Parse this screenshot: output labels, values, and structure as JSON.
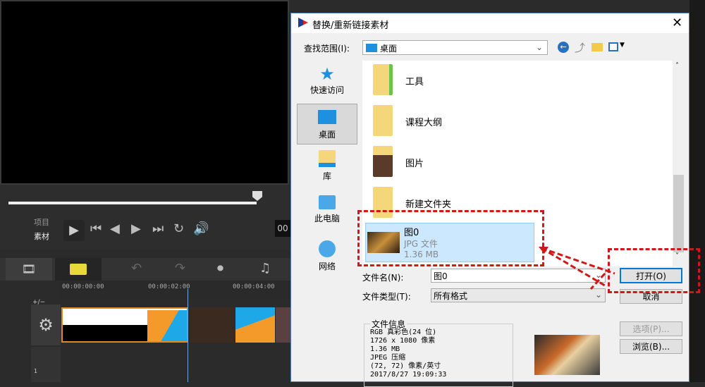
{
  "app": {
    "source_labels": [
      "项目",
      "素材"
    ],
    "timecodes": [
      "00:00:00:00",
      "00:00:02:00",
      "00:00:04:00"
    ],
    "track_label": "+/−",
    "track_number": "1",
    "timecode_box": "00"
  },
  "dialog": {
    "title": "替换/重新链接素材",
    "look_in_label": "查找范围(I):",
    "look_in_value": "桌面",
    "nav": [
      {
        "label": "快速访问",
        "icon": "star-icon"
      },
      {
        "label": "桌面",
        "icon": "desktop-icon",
        "selected": true
      },
      {
        "label": "库",
        "icon": "library-icon"
      },
      {
        "label": "此电脑",
        "icon": "computer-icon"
      },
      {
        "label": "网络",
        "icon": "network-icon"
      }
    ],
    "files": [
      {
        "name": "工具"
      },
      {
        "name": "课程大纲"
      },
      {
        "name": "图片"
      },
      {
        "name": "新建文件夹"
      }
    ],
    "selected_file": {
      "name": "图0",
      "type": "JPG 文件",
      "size": "1.36 MB"
    },
    "filename_label": "文件名(N):",
    "filename_value": "图0",
    "filetype_label": "文件类型(T):",
    "filetype_value": "所有格式",
    "open_button": "打开(O)",
    "cancel_button": "取消",
    "options_button": "选项(P)...",
    "browse_button": "浏览(B)...",
    "info_title": "文件信息",
    "info_lines": [
      "RGB 真彩色(24 位)",
      "1726 x 1080 像素",
      "1.36 MB",
      "JPEG 压缩",
      "(72, 72) 像素/英寸",
      "2017/8/27  19:09:33"
    ],
    "accent": "#0078d7",
    "highlight_color": "#d01818"
  }
}
